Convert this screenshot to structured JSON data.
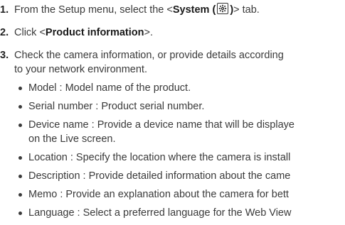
{
  "steps": [
    {
      "number": "1.",
      "pre": "From the Setup menu, select the <",
      "bold": "System (",
      "icon": "gear-icon",
      "bold_after": ")",
      "post": "> tab."
    },
    {
      "number": "2.",
      "pre": "Click <",
      "bold": "Product information",
      "post": ">."
    },
    {
      "number": "3.",
      "text_line1": "Check the camera information, or provide details according",
      "text_line2": "to your network environment."
    }
  ],
  "bullets": [
    {
      "line1": "Model : Model name of the product."
    },
    {
      "line1": "Serial number : Product serial number."
    },
    {
      "line1": "Device name : Provide a device name that will be displaye",
      "line2": "on the Live screen."
    },
    {
      "line1": "Location : Specify the location where the camera is install"
    },
    {
      "line1": "Description : Provide detailed information about the came"
    },
    {
      "line1": "Memo : Provide an explanation about the camera for bett"
    },
    {
      "line1": "Language : Select a preferred language for the Web View"
    }
  ]
}
